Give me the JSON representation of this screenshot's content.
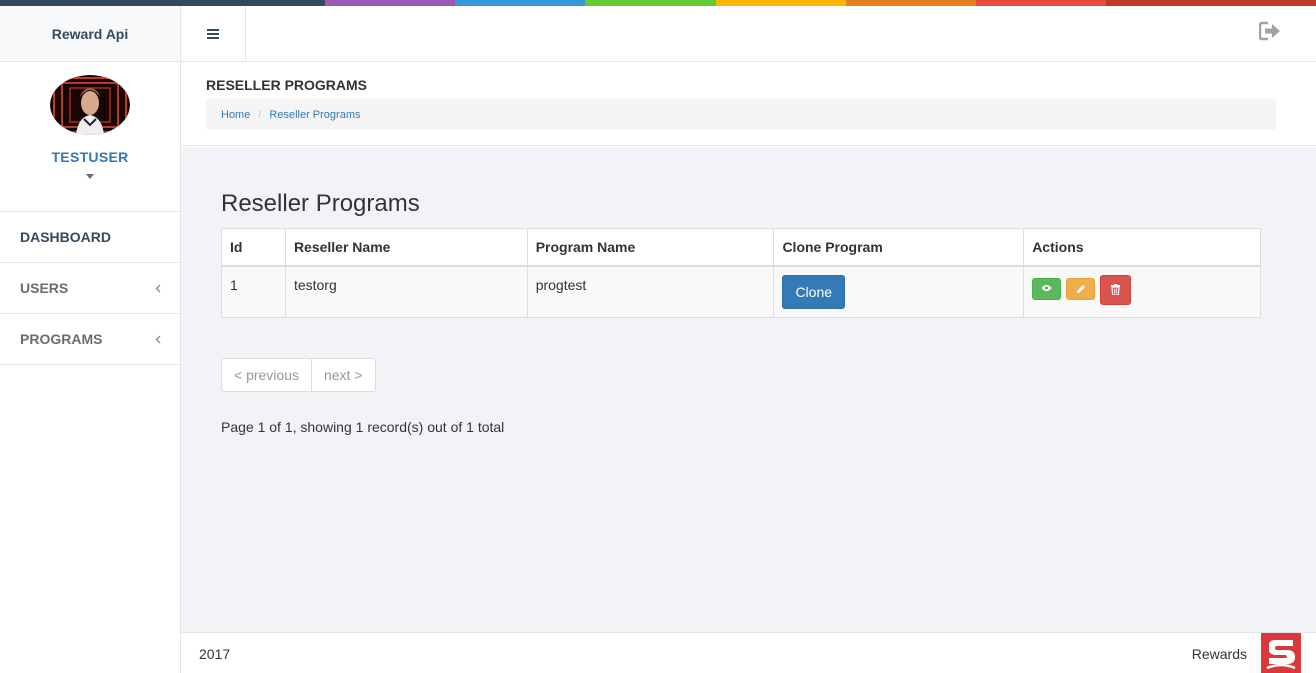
{
  "color_bar": [
    "#34495e",
    "#9b59b6",
    "#3498db",
    "#62cb31",
    "#ffb606",
    "#e67e22",
    "#e74c3c",
    "#c0392b"
  ],
  "brand": {
    "title": "Reward Api"
  },
  "user": {
    "name": "TESTUSER"
  },
  "nav": {
    "items": [
      {
        "label": "DASHBOARD",
        "has_submenu": false
      },
      {
        "label": "USERS",
        "has_submenu": true
      },
      {
        "label": "PROGRAMS",
        "has_submenu": true
      }
    ]
  },
  "page": {
    "title": "RESELLER PROGRAMS",
    "breadcrumb": [
      "Home",
      "Reseller Programs"
    ]
  },
  "content": {
    "heading": "Reseller Programs",
    "columns": [
      "Id",
      "Reseller Name",
      "Program Name",
      "Clone Program",
      "Actions"
    ],
    "rows": [
      {
        "id": "1",
        "reseller": "testorg",
        "program": "progtest",
        "clone_label": "Clone"
      }
    ],
    "pager": {
      "previous": "< previous",
      "next": "next >"
    },
    "page_info": "Page 1 of 1, showing 1 record(s) out of 1 total"
  },
  "footer": {
    "year": "2017",
    "brand": "Rewards"
  },
  "icons": {
    "menu": "hamburger-icon",
    "logout": "sign-out-icon",
    "view": "eye-icon",
    "edit": "pencil-icon",
    "delete": "trash-icon"
  },
  "colors": {
    "primary": "#337ab7",
    "success": "#5cb85c",
    "warning": "#f0ad4e",
    "danger": "#d9534f"
  }
}
